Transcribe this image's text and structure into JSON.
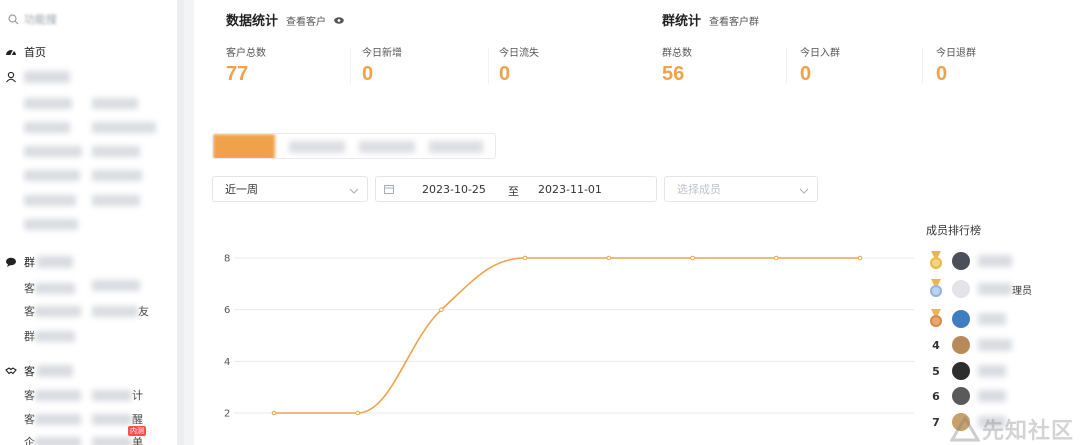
{
  "sidebar": {
    "search_placeholder": "功能搜",
    "groups": [
      {
        "icon": "dashboard-icon",
        "label": "首页"
      },
      {
        "icon": "user-icon",
        "label": ""
      },
      {
        "icon": "chat-icon",
        "label": "群"
      },
      {
        "icon": "handshake-icon",
        "label": "客"
      }
    ],
    "sub_items": {
      "g2a": "客",
      "g2b": "客",
      "g2c": "友",
      "g2d": "群",
      "g3a": "客",
      "g3b": "计",
      "g3c": "客",
      "g3d": "醒",
      "g3e": "企",
      "g3f": "单"
    },
    "badge": "内测"
  },
  "data_stats": {
    "title": "数据统计",
    "link": "查看客户",
    "items": [
      {
        "label": "客户总数",
        "value": "77"
      },
      {
        "label": "今日新增",
        "value": "0"
      },
      {
        "label": "今日流失",
        "value": "0"
      }
    ]
  },
  "group_stats": {
    "title": "群统计",
    "link": "查看客户群",
    "items": [
      {
        "label": "群总数",
        "value": "56"
      },
      {
        "label": "今日入群",
        "value": "0"
      },
      {
        "label": "今日退群",
        "value": "0"
      }
    ]
  },
  "filters": {
    "period": "近一周",
    "start_date": "2023-10-25",
    "to": "至",
    "end_date": "2023-11-01",
    "member_placeholder": "选择成员"
  },
  "chart_data": {
    "type": "line",
    "x": [
      1,
      2,
      3,
      4,
      5,
      6,
      7,
      8
    ],
    "series": [
      {
        "values": [
          2,
          2,
          6,
          8,
          8,
          8,
          8,
          8
        ]
      }
    ],
    "yticks": [
      "8",
      "6",
      "4",
      "2"
    ],
    "ylim": [
      2,
      8
    ],
    "color": "#f0a24a",
    "grid": true
  },
  "ranking": {
    "title": "成员排行榜",
    "items": [
      {
        "rank": "1",
        "type": "gold-medal-icon",
        "suffix": ""
      },
      {
        "rank": "2",
        "type": "silver-medal-icon",
        "suffix": "理员"
      },
      {
        "rank": "3",
        "type": "bronze-medal-icon",
        "suffix": ""
      },
      {
        "rank": "4",
        "type": "number",
        "suffix": ""
      },
      {
        "rank": "5",
        "type": "number",
        "suffix": ""
      },
      {
        "rank": "6",
        "type": "number",
        "suffix": ""
      },
      {
        "rank": "7",
        "type": "number",
        "suffix": ""
      }
    ]
  },
  "watermark": "先知社区",
  "colors": {
    "accent": "#f0a24a",
    "badge": "#ff4d4f"
  }
}
